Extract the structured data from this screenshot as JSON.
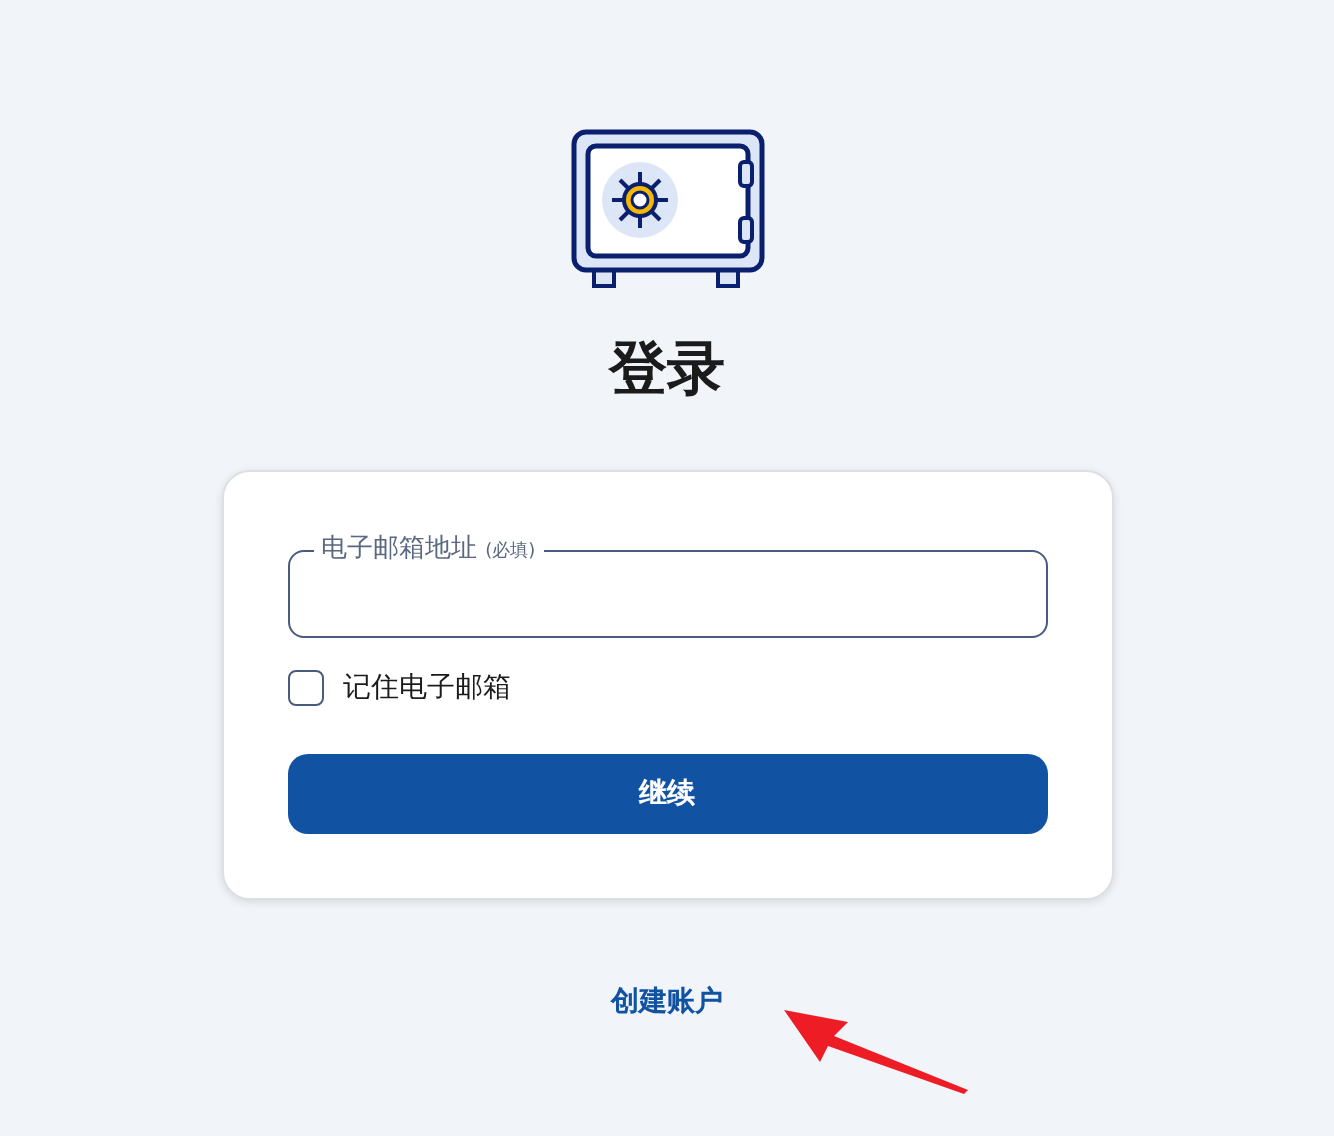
{
  "title": "登录",
  "email_field": {
    "label": "电子邮箱地址",
    "required_note": "(必填)"
  },
  "remember": {
    "label": "记住电子邮箱",
    "checked": false
  },
  "continue_button": "继续",
  "create_account_link": "创建账户",
  "annotation": {
    "kind": "arrow"
  }
}
